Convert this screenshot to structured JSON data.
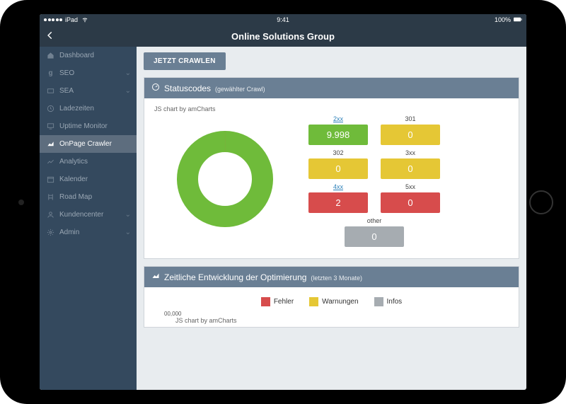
{
  "status_bar": {
    "carrier": "iPad",
    "time": "9:41",
    "battery": "100%"
  },
  "nav": {
    "title": "Online Solutions Group"
  },
  "sidebar": {
    "items": [
      {
        "label": "Dashboard",
        "icon": "home-icon",
        "expandable": false
      },
      {
        "label": "SEO",
        "icon": "seo-icon",
        "expandable": true
      },
      {
        "label": "SEA",
        "icon": "sea-icon",
        "expandable": true
      },
      {
        "label": "Ladezeiten",
        "icon": "clock-icon",
        "expandable": false
      },
      {
        "label": "Uptime Monitor",
        "icon": "monitor-icon",
        "expandable": false
      },
      {
        "label": "OnPage Crawler",
        "icon": "chart-area-icon",
        "expandable": false,
        "active": true
      },
      {
        "label": "Analytics",
        "icon": "analytics-icon",
        "expandable": false
      },
      {
        "label": "Kalender",
        "icon": "calendar-icon",
        "expandable": false
      },
      {
        "label": "Road Map",
        "icon": "roadmap-icon",
        "expandable": false
      },
      {
        "label": "Kundencenter",
        "icon": "user-icon",
        "expandable": true
      },
      {
        "label": "Admin",
        "icon": "settings-icon",
        "expandable": true
      }
    ]
  },
  "actions": {
    "crawl_button": "JETZT CRAWLEN"
  },
  "panel_status": {
    "title": "Statuscodes",
    "subtitle": "(gewählter Crawl)",
    "chart_attribution": "JS chart by amCharts",
    "cards": {
      "r1": [
        {
          "label": "2xx",
          "value": "9.998",
          "color": "c-green",
          "link": true
        },
        {
          "label": "301",
          "value": "0",
          "color": "c-yellow",
          "link": false
        }
      ],
      "r2": [
        {
          "label": "302",
          "value": "0",
          "color": "c-yellow",
          "link": false
        },
        {
          "label": "3xx",
          "value": "0",
          "color": "c-yellow",
          "link": false
        }
      ],
      "r3": [
        {
          "label": "4xx",
          "value": "2",
          "color": "c-red",
          "link": true
        },
        {
          "label": "5xx",
          "value": "0",
          "color": "c-red",
          "link": false
        }
      ],
      "r4": [
        {
          "label": "other",
          "value": "0",
          "color": "c-gray",
          "link": false
        }
      ]
    }
  },
  "panel_timeline": {
    "title": "Zeitliche Entwicklung der Optimierung",
    "subtitle": "(letzten 3 Monate)",
    "legend": [
      {
        "label": "Fehler",
        "swatch": "sw-red"
      },
      {
        "label": "Warnungen",
        "swatch": "sw-yellow"
      },
      {
        "label": "Infos",
        "swatch": "sw-gray"
      }
    ],
    "axis_start": "00,000",
    "chart_attribution": "JS chart by amCharts"
  },
  "chart_data": {
    "type": "pie",
    "title": "Statuscodes (gewählter Crawl)",
    "series": [
      {
        "name": "2xx",
        "value": 9998,
        "color": "#6fbb3a"
      },
      {
        "name": "301",
        "value": 0,
        "color": "#e5c735"
      },
      {
        "name": "302",
        "value": 0,
        "color": "#e5c735"
      },
      {
        "name": "3xx",
        "value": 0,
        "color": "#e5c735"
      },
      {
        "name": "4xx",
        "value": 2,
        "color": "#d74c4c"
      },
      {
        "name": "5xx",
        "value": 0,
        "color": "#d74c4c"
      },
      {
        "name": "other",
        "value": 0,
        "color": "#a6acb1"
      }
    ]
  }
}
